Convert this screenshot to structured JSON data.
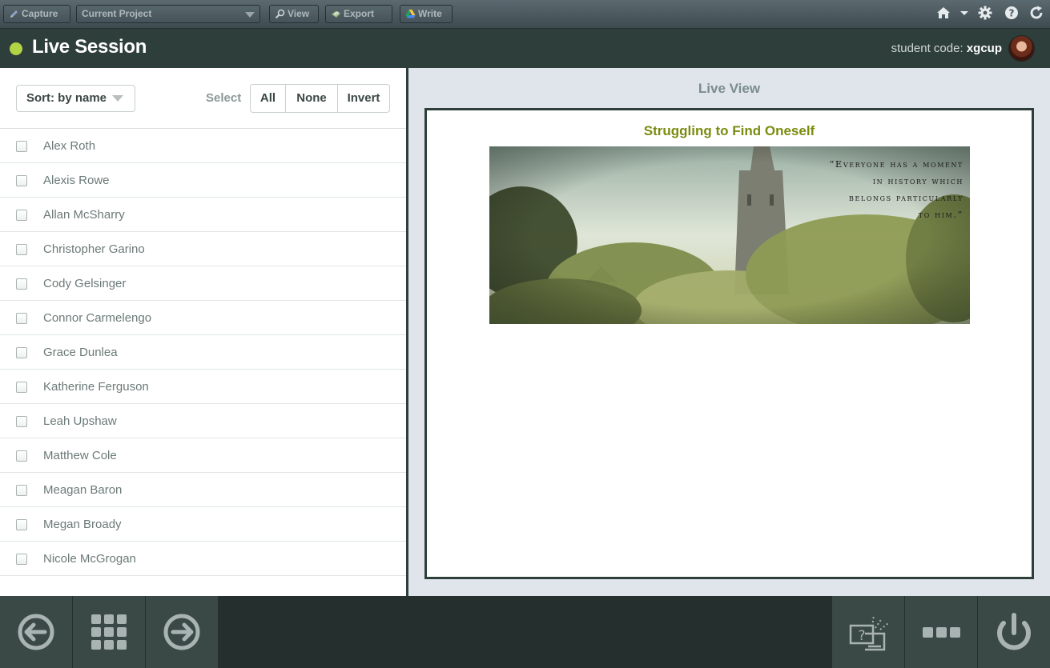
{
  "toolbar": {
    "capture_label": "Capture",
    "project_select": "Current Project",
    "view_label": "View",
    "export_label": "Export",
    "write_label": "Write",
    "icons": [
      "home-icon",
      "chevron-down-icon",
      "gear-icon",
      "help-icon",
      "refresh-icon"
    ]
  },
  "session": {
    "title": "Live Session",
    "status_color": "#b3d444",
    "code_label": "student code:",
    "code_value": "xgcup"
  },
  "students": {
    "sort_label": "Sort: by name",
    "select_label": "Select",
    "select_all": "All",
    "select_none": "None",
    "select_invert": "Invert",
    "names": [
      "Alex Roth",
      "Alexis Rowe",
      "Allan McSharry",
      "Christopher Garino",
      "Cody Gelsinger",
      "Connor Carmelengo",
      "Grace Dunlea",
      "Katherine Ferguson",
      "Leah Upshaw",
      "Matthew Cole",
      "Meagan Baron",
      "Megan Broady",
      "Nicole McGrogan"
    ]
  },
  "live_view": {
    "label": "Live View",
    "slide_title": "Struggling to Find Oneself",
    "quote": "“Everyone has a moment\nin history which\nbelongs particularly\nto him.”"
  },
  "bottom_bar": {
    "icons": [
      "arrow-left-icon",
      "grid-icon",
      "arrow-right-icon",
      "quiz-icon",
      "more-icon",
      "power-icon"
    ]
  },
  "colors": {
    "header_bg": "#2e3e3b",
    "accent_green": "#7a8c0f",
    "bottom_bg": "#252f2e"
  }
}
